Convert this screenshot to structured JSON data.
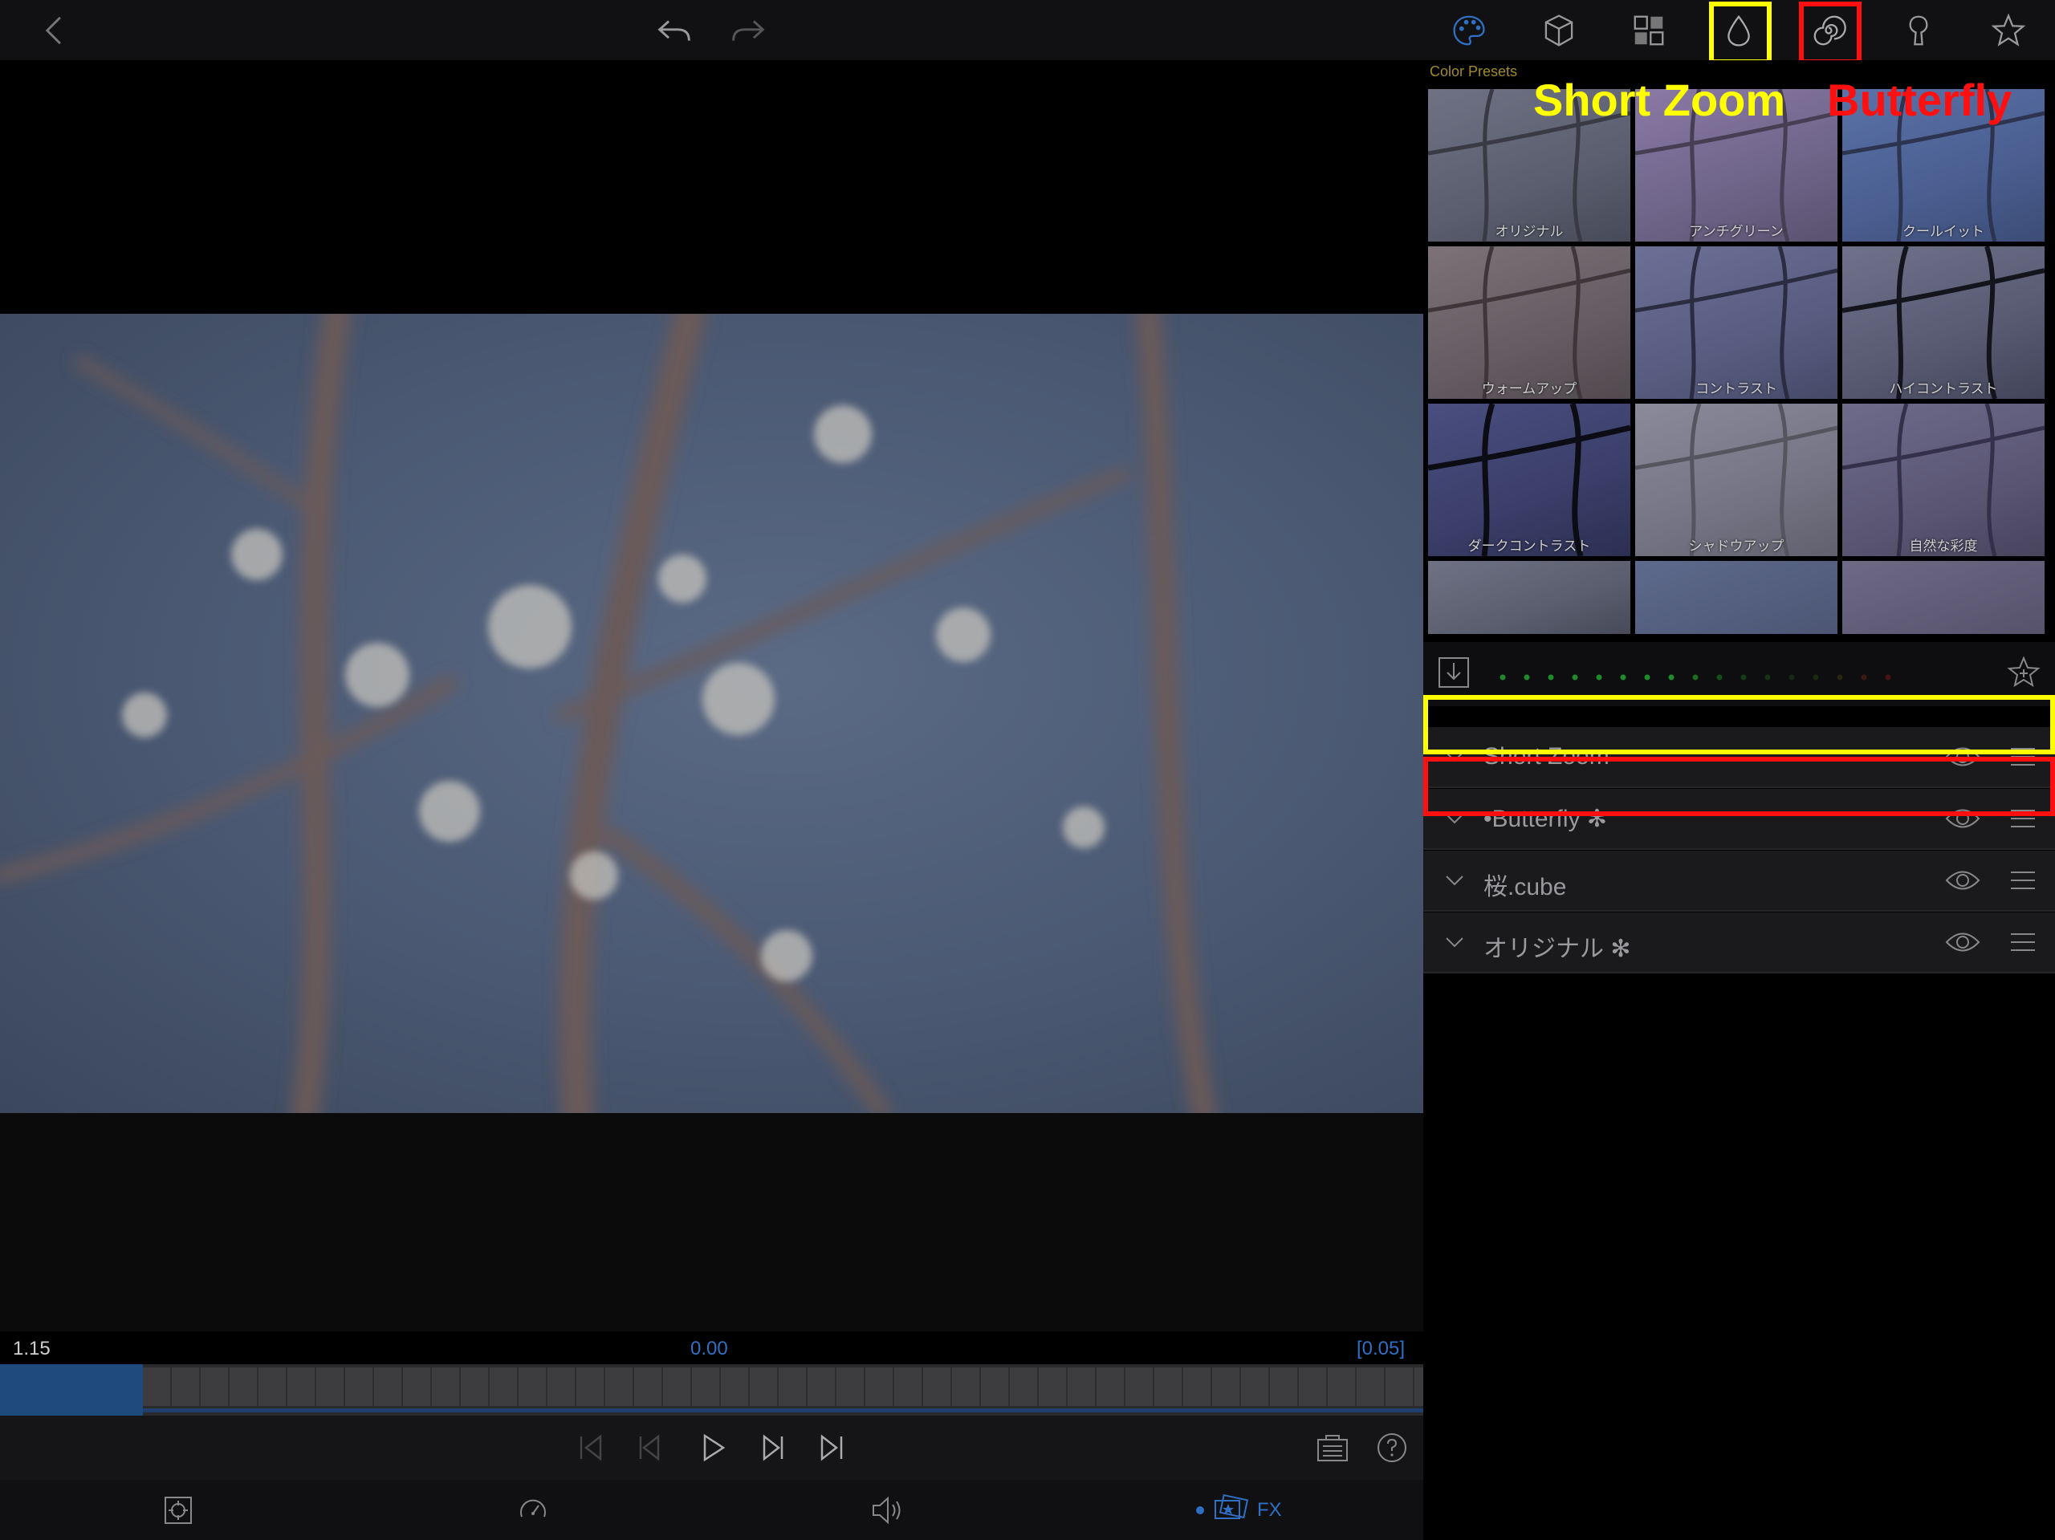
{
  "toolbar": {
    "back_icon": "chevron-left-icon",
    "undo_icon": "undo-icon",
    "redo_icon": "redo-icon",
    "tools": [
      "palette-icon",
      "cube-icon",
      "grid-icon",
      "drop-icon",
      "spiral-icon",
      "keyhole-icon",
      "star-icon"
    ]
  },
  "annotations": {
    "short_zoom_label": "Short Zoom",
    "butterfly_label": "Butterfly",
    "yellow": "#ffff00",
    "red": "#ff1010"
  },
  "presets": {
    "title": "Color Presets",
    "items": [
      {
        "label": "オリジナル"
      },
      {
        "label": "アンチグリーン"
      },
      {
        "label": "クールイット"
      },
      {
        "label": "ウォームアップ"
      },
      {
        "label": "コントラスト"
      },
      {
        "label": "ハイコントラスト"
      },
      {
        "label": "ダークコントラスト"
      },
      {
        "label": "シャドウアップ"
      },
      {
        "label": "自然な彩度"
      }
    ]
  },
  "effects": [
    {
      "name": "Short Zoom"
    },
    {
      "name": "•Butterfly ✻"
    },
    {
      "name": "桜.cube"
    },
    {
      "name": "オリジナル ✻"
    }
  ],
  "timeline": {
    "left_time": "1.15",
    "center_time": "0.00",
    "right_time": "[0.05]"
  },
  "bottom_tabs": {
    "fx_label": "FX"
  },
  "colors": {
    "accent_blue": "#2f6fc4",
    "preset_title": "#a08a2a"
  }
}
